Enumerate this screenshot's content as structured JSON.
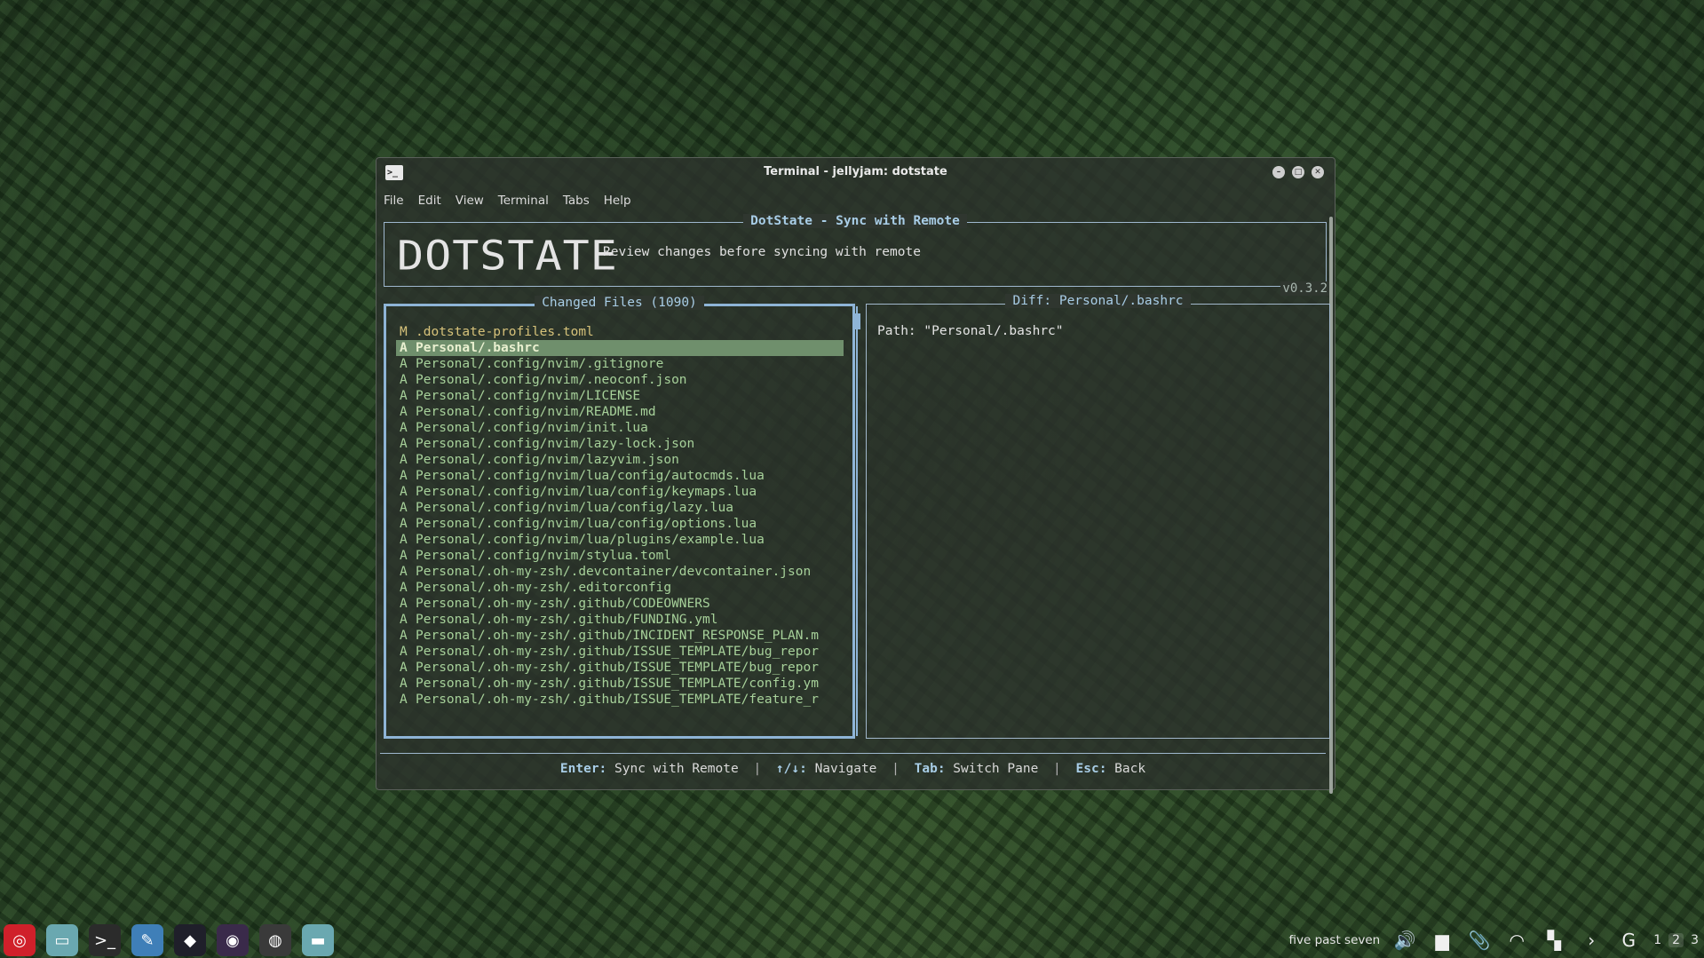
{
  "window": {
    "title": "Terminal - jellyjam: dotstate",
    "controls": {
      "minimize": "–",
      "maximize": "□",
      "close": "✕"
    },
    "menu": [
      "File",
      "Edit",
      "View",
      "Terminal",
      "Tabs",
      "Help"
    ]
  },
  "app": {
    "header_title": "DotState - Sync with Remote",
    "logo": "DOTSTATE",
    "subtitle": "Review changes before syncing with remote",
    "version": "v0.3.2"
  },
  "left_pane": {
    "title": "Changed Files (1090)",
    "files": [
      {
        "status": "M",
        "path": ".dotstate-profiles.toml",
        "selected": false
      },
      {
        "status": "A",
        "path": "Personal/.bashrc",
        "selected": true
      },
      {
        "status": "A",
        "path": "Personal/.config/nvim/.gitignore",
        "selected": false
      },
      {
        "status": "A",
        "path": "Personal/.config/nvim/.neoconf.json",
        "selected": false
      },
      {
        "status": "A",
        "path": "Personal/.config/nvim/LICENSE",
        "selected": false
      },
      {
        "status": "A",
        "path": "Personal/.config/nvim/README.md",
        "selected": false
      },
      {
        "status": "A",
        "path": "Personal/.config/nvim/init.lua",
        "selected": false
      },
      {
        "status": "A",
        "path": "Personal/.config/nvim/lazy-lock.json",
        "selected": false
      },
      {
        "status": "A",
        "path": "Personal/.config/nvim/lazyvim.json",
        "selected": false
      },
      {
        "status": "A",
        "path": "Personal/.config/nvim/lua/config/autocmds.lua",
        "selected": false
      },
      {
        "status": "A",
        "path": "Personal/.config/nvim/lua/config/keymaps.lua",
        "selected": false
      },
      {
        "status": "A",
        "path": "Personal/.config/nvim/lua/config/lazy.lua",
        "selected": false
      },
      {
        "status": "A",
        "path": "Personal/.config/nvim/lua/config/options.lua",
        "selected": false
      },
      {
        "status": "A",
        "path": "Personal/.config/nvim/lua/plugins/example.lua",
        "selected": false
      },
      {
        "status": "A",
        "path": "Personal/.config/nvim/stylua.toml",
        "selected": false
      },
      {
        "status": "A",
        "path": "Personal/.oh-my-zsh/.devcontainer/devcontainer.json",
        "selected": false
      },
      {
        "status": "A",
        "path": "Personal/.oh-my-zsh/.editorconfig",
        "selected": false
      },
      {
        "status": "A",
        "path": "Personal/.oh-my-zsh/.github/CODEOWNERS",
        "selected": false
      },
      {
        "status": "A",
        "path": "Personal/.oh-my-zsh/.github/FUNDING.yml",
        "selected": false
      },
      {
        "status": "A",
        "path": "Personal/.oh-my-zsh/.github/INCIDENT_RESPONSE_PLAN.m",
        "selected": false
      },
      {
        "status": "A",
        "path": "Personal/.oh-my-zsh/.github/ISSUE_TEMPLATE/bug_repor",
        "selected": false
      },
      {
        "status": "A",
        "path": "Personal/.oh-my-zsh/.github/ISSUE_TEMPLATE/bug_repor",
        "selected": false
      },
      {
        "status": "A",
        "path": "Personal/.oh-my-zsh/.github/ISSUE_TEMPLATE/config.ym",
        "selected": false
      },
      {
        "status": "A",
        "path": "Personal/.oh-my-zsh/.github/ISSUE_TEMPLATE/feature_r",
        "selected": false
      }
    ]
  },
  "right_pane": {
    "title": "Diff: Personal/.bashrc",
    "path_line": "Path: \"Personal/.bashrc\""
  },
  "footer": {
    "items": [
      {
        "key": "Enter:",
        "action": "Sync with Remote"
      },
      {
        "key": "↑/↓:",
        "action": "Navigate"
      },
      {
        "key": "Tab:",
        "action": "Switch Pane"
      },
      {
        "key": "Esc:",
        "action": "Back"
      }
    ],
    "separator": "|"
  },
  "taskbar": {
    "apps": [
      {
        "icon": "debian-swirl-icon",
        "glyph": "◎",
        "bg": "#d0202a"
      },
      {
        "icon": "file-manager-icon",
        "glyph": "▭",
        "bg": "#6aa8b0"
      },
      {
        "icon": "terminal-icon",
        "glyph": ">_",
        "bg": "#2b2b2b"
      },
      {
        "icon": "text-editor-icon",
        "glyph": "✎",
        "bg": "#3f7fb8"
      },
      {
        "icon": "obsidian-icon",
        "glyph": "◆",
        "bg": "#1f1f2a"
      },
      {
        "icon": "firefox-icon",
        "glyph": "◉",
        "bg": "#3a2a4a"
      },
      {
        "icon": "chrome-icon",
        "glyph": "◍",
        "bg": "#3a3a3a"
      },
      {
        "icon": "folder-icon",
        "glyph": "▬",
        "bg": "#6aa8b0"
      }
    ],
    "clock": "five past seven",
    "tray": [
      {
        "icon": "volume-icon",
        "glyph": "🔊"
      },
      {
        "icon": "notes-icon",
        "glyph": "▆"
      },
      {
        "icon": "paperclip-icon",
        "glyph": "📎"
      },
      {
        "icon": "wifi-icon",
        "glyph": "◠"
      },
      {
        "icon": "color-picker-icon",
        "glyph": "▚"
      },
      {
        "icon": "chevron-right-icon",
        "glyph": "›"
      },
      {
        "icon": "update-icon",
        "glyph": "G"
      }
    ],
    "workspaces": [
      "1",
      "2",
      "3"
    ]
  }
}
